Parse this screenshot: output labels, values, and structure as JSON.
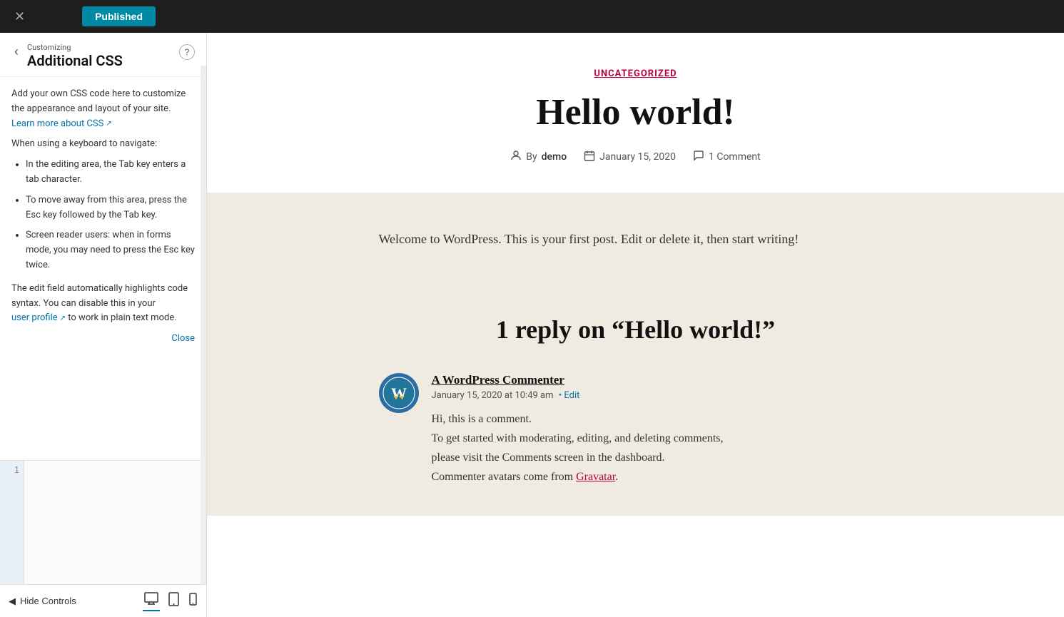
{
  "topbar": {
    "close_label": "✕",
    "published_label": "Published"
  },
  "sidebar": {
    "customizing_label": "Customizing",
    "title": "Additional CSS",
    "help_label": "?",
    "back_label": "‹",
    "description": "Add your own CSS code here to customize the appearance and layout of your site.",
    "learn_more_text": "Learn more about CSS",
    "keyboard_heading": "When using a keyboard to navigate:",
    "bullets": [
      "In the editing area, the Tab key enters a tab character.",
      "To move away from this area, press the Esc key followed by the Tab key.",
      "Screen reader users: when in forms mode, you may need to press the Esc key twice."
    ],
    "edit_field_note": "The edit field automatically highlights code syntax. You can disable this in your",
    "user_profile_text": "user profile",
    "plain_text_suffix": "to work in plain text mode.",
    "close_link": "Close",
    "line_number": "1"
  },
  "bottom_bar": {
    "hide_controls_label": "Hide Controls",
    "eye_icon": "◀",
    "desktop_icon": "🖥",
    "tablet_icon": "⬜",
    "mobile_icon": "📱"
  },
  "preview": {
    "category": "UNCATEGORIZED",
    "post_title": "Hello world!",
    "meta": {
      "author_prefix": "By",
      "author": "demo",
      "date": "January 15, 2020",
      "comments": "1 Comment"
    },
    "post_content": "Welcome to WordPress. This is your first post. Edit or delete it, then start writing!",
    "comments_title": "1 reply on “Hello world!”",
    "comment": {
      "name": "A WordPress Commenter",
      "date": "January 15, 2020 at 10:49 am",
      "edit_label": "• Edit",
      "text_line1": "Hi, this is a comment.",
      "text_line2": "To get started with moderating, editing, and deleting comments,",
      "text_line3": "please visit the Comments screen in the dashboard.",
      "text_line4": "Commenter avatars come from",
      "gravatar_link": "Gravatar",
      "text_line4_end": "."
    }
  }
}
